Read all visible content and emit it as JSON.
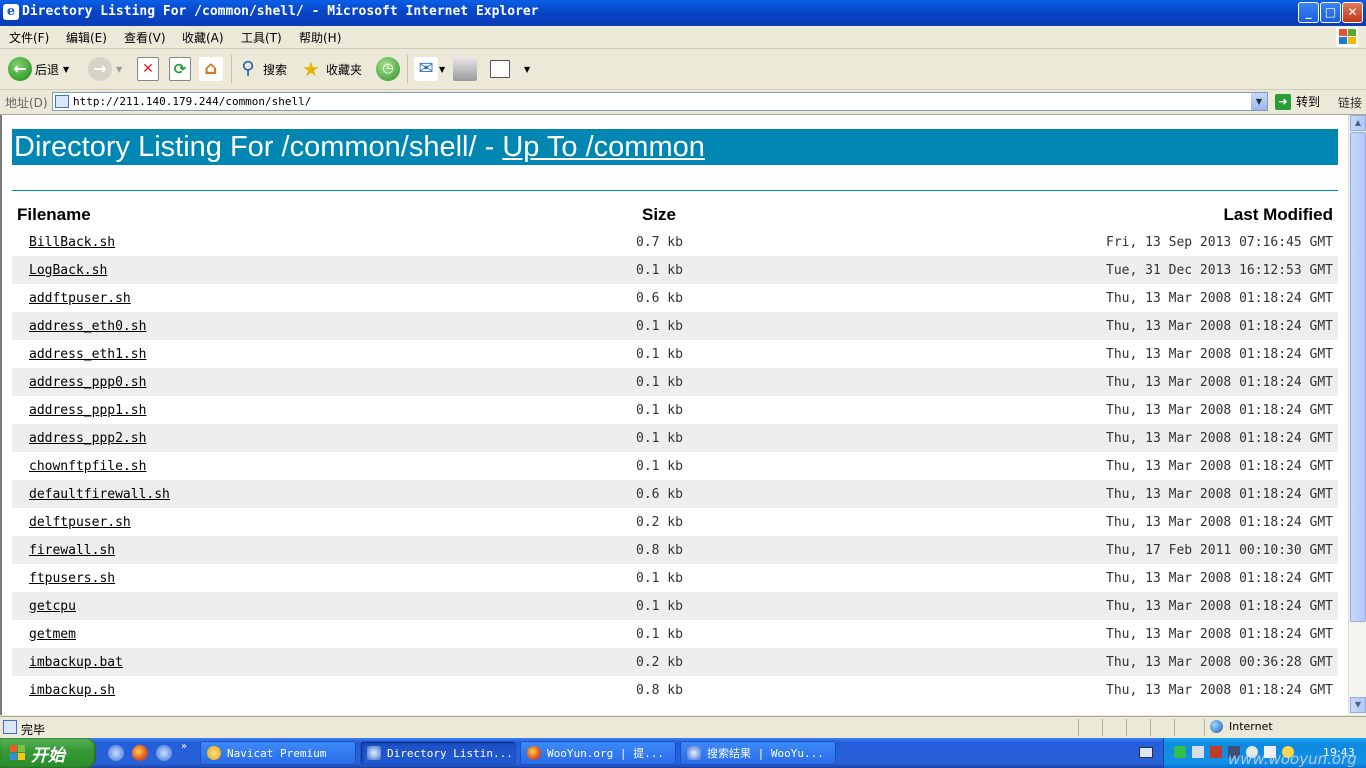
{
  "window": {
    "title": "Directory Listing For /common/shell/ - Microsoft Internet Explorer",
    "app_icon": "ie-icon",
    "buttons": {
      "minimize": "_",
      "maximize": "□",
      "close": "✕"
    }
  },
  "menubar": {
    "items": [
      "文件(F)",
      "编辑(E)",
      "查看(V)",
      "收藏(A)",
      "工具(T)",
      "帮助(H)"
    ]
  },
  "toolbar": {
    "back_label": "后退",
    "search_label": "搜索",
    "favorites_label": "收藏夹"
  },
  "addressbar": {
    "label": "地址(D)",
    "url": "http://211.140.179.244/common/shell/",
    "go_label": "转到",
    "links_label": "链接"
  },
  "page": {
    "heading_prefix": "Directory Listing For /common/shell/ - ",
    "heading_link": "Up To /common",
    "colors": {
      "accent": "#0086b3",
      "row_alt": "#eeeeee"
    },
    "columns": {
      "name": "Filename",
      "size": "Size",
      "modified": "Last Modified"
    },
    "files": [
      {
        "name": "BillBack.sh",
        "size": "0.7 kb",
        "modified": "Fri, 13 Sep 2013 07:16:45 GMT"
      },
      {
        "name": "LogBack.sh",
        "size": "0.1 kb",
        "modified": "Tue, 31 Dec 2013 16:12:53 GMT"
      },
      {
        "name": "addftpuser.sh",
        "size": "0.6 kb",
        "modified": "Thu, 13 Mar 2008 01:18:24 GMT"
      },
      {
        "name": "address_eth0.sh",
        "size": "0.1 kb",
        "modified": "Thu, 13 Mar 2008 01:18:24 GMT"
      },
      {
        "name": "address_eth1.sh",
        "size": "0.1 kb",
        "modified": "Thu, 13 Mar 2008 01:18:24 GMT"
      },
      {
        "name": "address_ppp0.sh",
        "size": "0.1 kb",
        "modified": "Thu, 13 Mar 2008 01:18:24 GMT"
      },
      {
        "name": "address_ppp1.sh",
        "size": "0.1 kb",
        "modified": "Thu, 13 Mar 2008 01:18:24 GMT"
      },
      {
        "name": "address_ppp2.sh",
        "size": "0.1 kb",
        "modified": "Thu, 13 Mar 2008 01:18:24 GMT"
      },
      {
        "name": "chownftpfile.sh",
        "size": "0.1 kb",
        "modified": "Thu, 13 Mar 2008 01:18:24 GMT"
      },
      {
        "name": "defaultfirewall.sh",
        "size": "0.6 kb",
        "modified": "Thu, 13 Mar 2008 01:18:24 GMT"
      },
      {
        "name": "delftpuser.sh",
        "size": "0.2 kb",
        "modified": "Thu, 13 Mar 2008 01:18:24 GMT"
      },
      {
        "name": "firewall.sh",
        "size": "0.8 kb",
        "modified": "Thu, 17 Feb 2011 00:10:30 GMT"
      },
      {
        "name": "ftpusers.sh",
        "size": "0.1 kb",
        "modified": "Thu, 13 Mar 2008 01:18:24 GMT"
      },
      {
        "name": "getcpu",
        "size": "0.1 kb",
        "modified": "Thu, 13 Mar 2008 01:18:24 GMT"
      },
      {
        "name": "getmem",
        "size": "0.1 kb",
        "modified": "Thu, 13 Mar 2008 01:18:24 GMT"
      },
      {
        "name": "imbackup.bat",
        "size": "0.2 kb",
        "modified": "Thu, 13 Mar 2008 00:36:28 GMT"
      },
      {
        "name": "imbackup.sh",
        "size": "0.8 kb",
        "modified": "Thu, 13 Mar 2008 01:18:24 GMT"
      }
    ]
  },
  "statusbar": {
    "text": "完毕",
    "zone": "Internet"
  },
  "taskbar": {
    "start_label": "开始",
    "quicklaunch": [
      "ie-icon",
      "firefox-icon",
      "ie-icon"
    ],
    "tasks": [
      {
        "label": "Navicat Premium",
        "icon": "navicat-icon",
        "active": false
      },
      {
        "label": "Directory Listin...",
        "icon": "ie-icon",
        "active": true
      },
      {
        "label": "WooYun.org | 提...",
        "icon": "firefox-icon",
        "active": false
      },
      {
        "label": "搜索结果 | WooYu...",
        "icon": "ie-icon",
        "active": false
      }
    ],
    "clock": "19:43",
    "watermark": "www.wooyun.org"
  }
}
